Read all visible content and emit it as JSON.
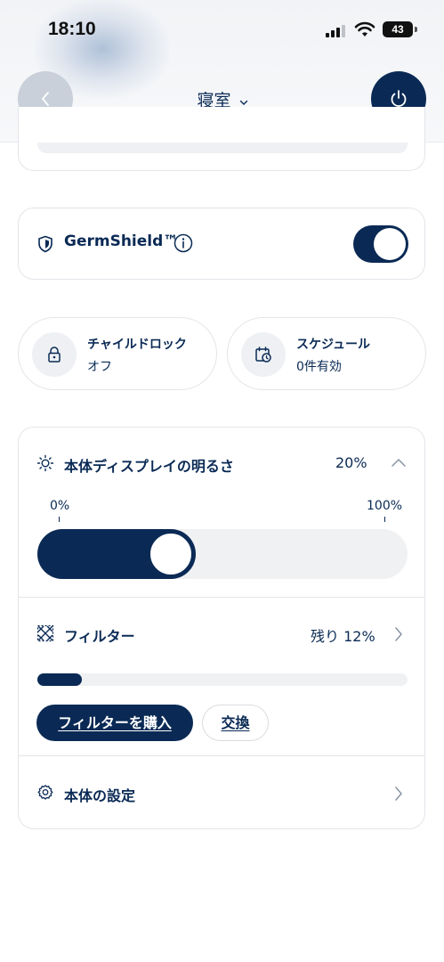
{
  "status_bar": {
    "time": "18:10",
    "battery": "43"
  },
  "header": {
    "title": "寝室",
    "back_icon": "chevron-left-icon",
    "power_icon": "power-icon"
  },
  "germshield": {
    "label": "GermShield™",
    "enabled": true
  },
  "child_lock": {
    "title": "チャイルドロック",
    "status": "オフ",
    "icon": "lock-icon"
  },
  "schedule": {
    "title": "スケジュール",
    "status": "0件有効",
    "icon": "calendar-clock-icon"
  },
  "brightness": {
    "label": "本体ディスプレイの明るさ",
    "value": "20%",
    "level_percent": 20,
    "min_label": "0%",
    "max_label": "100%"
  },
  "filter": {
    "label": "フィルター",
    "remaining": "残り 12%",
    "remaining_percent": 12,
    "buy_label": "フィルターを購入",
    "replace_label": "交換"
  },
  "device_settings": {
    "label": "本体の設定"
  },
  "colors": {
    "navy": "#0a2a55",
    "track": "#f0f1f3"
  }
}
